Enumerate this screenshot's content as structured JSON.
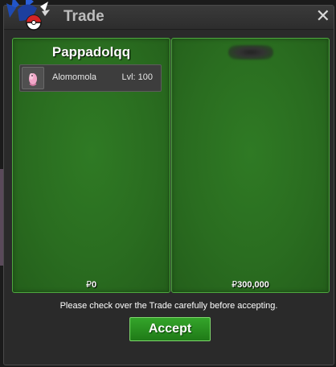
{
  "window": {
    "title": "Trade",
    "close_label": "✕"
  },
  "left_panel": {
    "player_name": "Pappadolqq",
    "items": [
      {
        "name": "Alomomola",
        "level": "Lvl: 100",
        "icon": "pokemon-icon"
      }
    ],
    "money_symbol": "₽",
    "money": "0"
  },
  "right_panel": {
    "player_name": "",
    "money_symbol": "₽",
    "money": "300,000"
  },
  "footer": {
    "notice": "Please check over the Trade carefully before accepting.",
    "accept_label": "Accept"
  },
  "colors": {
    "panel_green": "#2a6d20",
    "panel_border": "#4ea83f",
    "accept_green": "#2a8f22",
    "window_bg": "#2a2a2a"
  }
}
